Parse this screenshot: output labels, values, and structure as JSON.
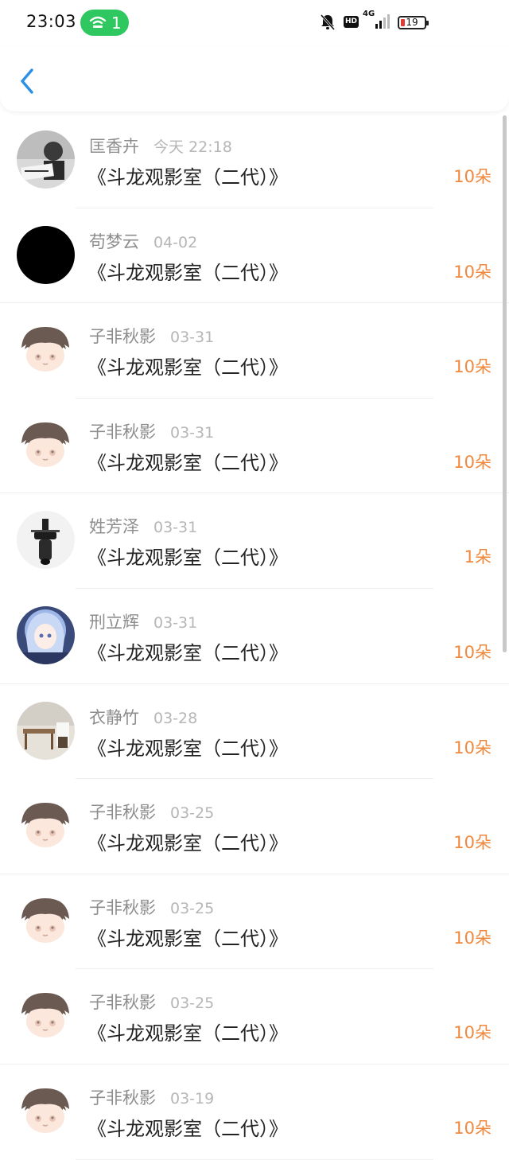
{
  "status_bar": {
    "time": "23:03",
    "hotspot_count": "1",
    "network": "4G",
    "hd": "HD",
    "battery": "19"
  },
  "header": {
    "back_icon": "chevron-left-icon"
  },
  "colors": {
    "accent": "#f0883d",
    "back": "#2b8fe6",
    "pill": "#2fc760"
  },
  "records": [
    {
      "name": "匡香卉",
      "date": "今天 22:18",
      "title": "《斗龙观影室（二代）》",
      "amount": "10朵",
      "avatar": "photo-man"
    },
    {
      "name": "苟梦云",
      "date": "04-02",
      "title": "《斗龙观影室（二代）》",
      "amount": "10朵",
      "avatar": "black"
    },
    {
      "name": "子非秋影",
      "date": "03-31",
      "title": "《斗龙观影室（二代）》",
      "amount": "10朵",
      "avatar": "anime-boy"
    },
    {
      "name": "子非秋影",
      "date": "03-31",
      "title": "《斗龙观影室（二代）》",
      "amount": "10朵",
      "avatar": "anime-boy"
    },
    {
      "name": "姓芳泽",
      "date": "03-31",
      "title": "《斗龙观影室（二代）》",
      "amount": "1朵",
      "avatar": "motorbike"
    },
    {
      "name": "刑立辉",
      "date": "03-31",
      "title": "《斗龙观影室（二代）》",
      "amount": "10朵",
      "avatar": "anime-girl"
    },
    {
      "name": "衣静竹",
      "date": "03-28",
      "title": "《斗龙观影室（二代）》",
      "amount": "10朵",
      "avatar": "room"
    },
    {
      "name": "子非秋影",
      "date": "03-25",
      "title": "《斗龙观影室（二代）》",
      "amount": "10朵",
      "avatar": "anime-boy"
    },
    {
      "name": "子非秋影",
      "date": "03-25",
      "title": "《斗龙观影室（二代）》",
      "amount": "10朵",
      "avatar": "anime-boy"
    },
    {
      "name": "子非秋影",
      "date": "03-25",
      "title": "《斗龙观影室（二代）》",
      "amount": "10朵",
      "avatar": "anime-boy"
    },
    {
      "name": "子非秋影",
      "date": "03-19",
      "title": "《斗龙观影室（二代）》",
      "amount": "10朵",
      "avatar": "anime-boy"
    }
  ]
}
